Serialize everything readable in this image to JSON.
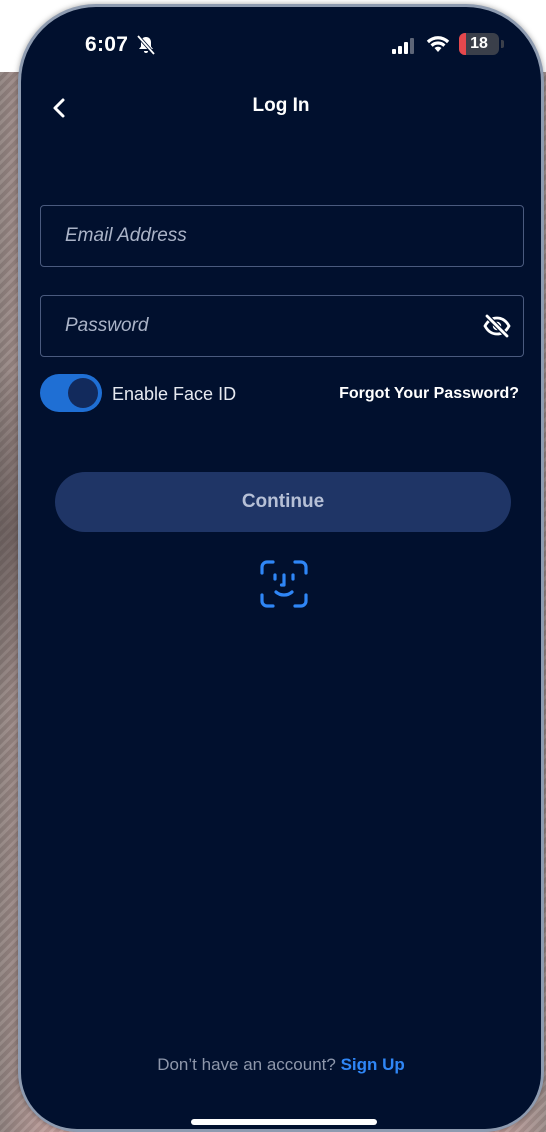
{
  "status_bar": {
    "time": "6:07",
    "battery_level": "18",
    "battery_fraction": 0.18,
    "icons": [
      "bell-muted-icon",
      "signal-icon",
      "wifi-icon",
      "battery-icon"
    ]
  },
  "header": {
    "back_icon": "chevron-left-icon",
    "title": "Log In"
  },
  "form": {
    "email": {
      "value": "",
      "placeholder": "Email Address"
    },
    "password": {
      "value": "",
      "placeholder": "Password",
      "toggle_icon": "eye-off-icon"
    },
    "face_id_toggle": {
      "label": "Enable Face ID",
      "checked": true
    },
    "forgot_password": "Forgot Your Password?",
    "continue_label": "Continue",
    "face_id_icon": "face-id-icon"
  },
  "footer": {
    "prompt": "Don’t have an account?",
    "signup_label": "Sign Up"
  },
  "colors": {
    "background": "#01102e",
    "accent": "#1f6fd4",
    "link": "#2f86f6",
    "button": "#1f3566"
  }
}
